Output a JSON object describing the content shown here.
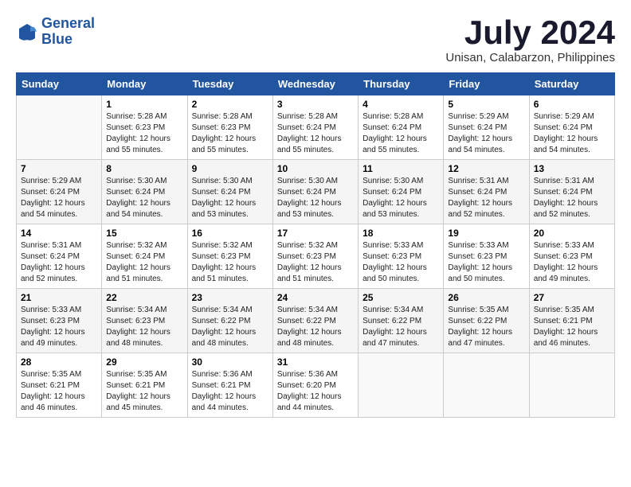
{
  "header": {
    "logo_line1": "General",
    "logo_line2": "Blue",
    "month_title": "July 2024",
    "subtitle": "Unisan, Calabarzon, Philippines"
  },
  "days_of_week": [
    "Sunday",
    "Monday",
    "Tuesday",
    "Wednesday",
    "Thursday",
    "Friday",
    "Saturday"
  ],
  "weeks": [
    [
      {
        "day": "",
        "info": ""
      },
      {
        "day": "1",
        "info": "Sunrise: 5:28 AM\nSunset: 6:23 PM\nDaylight: 12 hours\nand 55 minutes."
      },
      {
        "day": "2",
        "info": "Sunrise: 5:28 AM\nSunset: 6:23 PM\nDaylight: 12 hours\nand 55 minutes."
      },
      {
        "day": "3",
        "info": "Sunrise: 5:28 AM\nSunset: 6:24 PM\nDaylight: 12 hours\nand 55 minutes."
      },
      {
        "day": "4",
        "info": "Sunrise: 5:28 AM\nSunset: 6:24 PM\nDaylight: 12 hours\nand 55 minutes."
      },
      {
        "day": "5",
        "info": "Sunrise: 5:29 AM\nSunset: 6:24 PM\nDaylight: 12 hours\nand 54 minutes."
      },
      {
        "day": "6",
        "info": "Sunrise: 5:29 AM\nSunset: 6:24 PM\nDaylight: 12 hours\nand 54 minutes."
      }
    ],
    [
      {
        "day": "7",
        "info": "Sunrise: 5:29 AM\nSunset: 6:24 PM\nDaylight: 12 hours\nand 54 minutes."
      },
      {
        "day": "8",
        "info": "Sunrise: 5:30 AM\nSunset: 6:24 PM\nDaylight: 12 hours\nand 54 minutes."
      },
      {
        "day": "9",
        "info": "Sunrise: 5:30 AM\nSunset: 6:24 PM\nDaylight: 12 hours\nand 53 minutes."
      },
      {
        "day": "10",
        "info": "Sunrise: 5:30 AM\nSunset: 6:24 PM\nDaylight: 12 hours\nand 53 minutes."
      },
      {
        "day": "11",
        "info": "Sunrise: 5:30 AM\nSunset: 6:24 PM\nDaylight: 12 hours\nand 53 minutes."
      },
      {
        "day": "12",
        "info": "Sunrise: 5:31 AM\nSunset: 6:24 PM\nDaylight: 12 hours\nand 52 minutes."
      },
      {
        "day": "13",
        "info": "Sunrise: 5:31 AM\nSunset: 6:24 PM\nDaylight: 12 hours\nand 52 minutes."
      }
    ],
    [
      {
        "day": "14",
        "info": "Sunrise: 5:31 AM\nSunset: 6:24 PM\nDaylight: 12 hours\nand 52 minutes."
      },
      {
        "day": "15",
        "info": "Sunrise: 5:32 AM\nSunset: 6:24 PM\nDaylight: 12 hours\nand 51 minutes."
      },
      {
        "day": "16",
        "info": "Sunrise: 5:32 AM\nSunset: 6:23 PM\nDaylight: 12 hours\nand 51 minutes."
      },
      {
        "day": "17",
        "info": "Sunrise: 5:32 AM\nSunset: 6:23 PM\nDaylight: 12 hours\nand 51 minutes."
      },
      {
        "day": "18",
        "info": "Sunrise: 5:33 AM\nSunset: 6:23 PM\nDaylight: 12 hours\nand 50 minutes."
      },
      {
        "day": "19",
        "info": "Sunrise: 5:33 AM\nSunset: 6:23 PM\nDaylight: 12 hours\nand 50 minutes."
      },
      {
        "day": "20",
        "info": "Sunrise: 5:33 AM\nSunset: 6:23 PM\nDaylight: 12 hours\nand 49 minutes."
      }
    ],
    [
      {
        "day": "21",
        "info": "Sunrise: 5:33 AM\nSunset: 6:23 PM\nDaylight: 12 hours\nand 49 minutes."
      },
      {
        "day": "22",
        "info": "Sunrise: 5:34 AM\nSunset: 6:23 PM\nDaylight: 12 hours\nand 48 minutes."
      },
      {
        "day": "23",
        "info": "Sunrise: 5:34 AM\nSunset: 6:22 PM\nDaylight: 12 hours\nand 48 minutes."
      },
      {
        "day": "24",
        "info": "Sunrise: 5:34 AM\nSunset: 6:22 PM\nDaylight: 12 hours\nand 48 minutes."
      },
      {
        "day": "25",
        "info": "Sunrise: 5:34 AM\nSunset: 6:22 PM\nDaylight: 12 hours\nand 47 minutes."
      },
      {
        "day": "26",
        "info": "Sunrise: 5:35 AM\nSunset: 6:22 PM\nDaylight: 12 hours\nand 47 minutes."
      },
      {
        "day": "27",
        "info": "Sunrise: 5:35 AM\nSunset: 6:21 PM\nDaylight: 12 hours\nand 46 minutes."
      }
    ],
    [
      {
        "day": "28",
        "info": "Sunrise: 5:35 AM\nSunset: 6:21 PM\nDaylight: 12 hours\nand 46 minutes."
      },
      {
        "day": "29",
        "info": "Sunrise: 5:35 AM\nSunset: 6:21 PM\nDaylight: 12 hours\nand 45 minutes."
      },
      {
        "day": "30",
        "info": "Sunrise: 5:36 AM\nSunset: 6:21 PM\nDaylight: 12 hours\nand 44 minutes."
      },
      {
        "day": "31",
        "info": "Sunrise: 5:36 AM\nSunset: 6:20 PM\nDaylight: 12 hours\nand 44 minutes."
      },
      {
        "day": "",
        "info": ""
      },
      {
        "day": "",
        "info": ""
      },
      {
        "day": "",
        "info": ""
      }
    ]
  ]
}
